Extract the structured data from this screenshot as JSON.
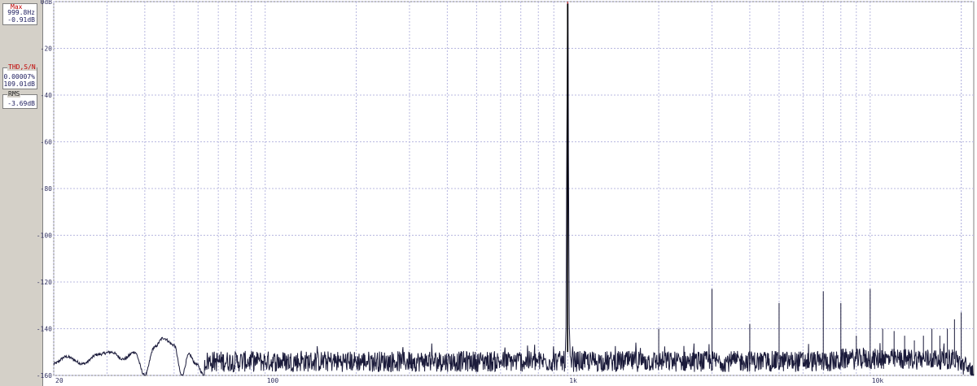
{
  "readouts": {
    "max": {
      "title": "Max",
      "freq": "999.8Hz",
      "level": "-0.91dB"
    },
    "thd": {
      "title": "THD,S/N",
      "thd": "0.00007%",
      "sn": "109.01dB"
    },
    "rms": {
      "title": "RMS",
      "level": "-3.69dB"
    }
  },
  "colors": {
    "trace": "#1a1a3a",
    "grid": "#b8b8e0",
    "panel": "#d4d0c8",
    "marker": "#c00000"
  },
  "chart_data": {
    "type": "line",
    "title": "",
    "xlabel": "",
    "ylabel": "",
    "xscale": "log",
    "xlim": [
      20,
      22000
    ],
    "ylim": [
      -160,
      0
    ],
    "grid": true,
    "yticks": [
      {
        "v": 0,
        "label": "0dB"
      },
      {
        "v": -20,
        "label": "-20"
      },
      {
        "v": -40,
        "label": "-40"
      },
      {
        "v": -60,
        "label": "-60"
      },
      {
        "v": -80,
        "label": "-80"
      },
      {
        "v": -100,
        "label": "-100"
      },
      {
        "v": -120,
        "label": "-120"
      },
      {
        "v": -140,
        "label": "-140"
      },
      {
        "v": -160,
        "label": "-160"
      }
    ],
    "xticks": [
      {
        "v": 20,
        "label": "20"
      },
      {
        "v": 100,
        "label": "100"
      },
      {
        "v": 1000,
        "label": "1k"
      },
      {
        "v": 10000,
        "label": "10k"
      }
    ],
    "noise_floor_db": -154,
    "low_freq_ripple": [
      {
        "f": 20,
        "db": -155
      },
      {
        "f": 22,
        "db": -152
      },
      {
        "f": 25,
        "db": -155
      },
      {
        "f": 28,
        "db": -151
      },
      {
        "f": 31,
        "db": -150
      },
      {
        "f": 34,
        "db": -153
      },
      {
        "f": 37,
        "db": -150
      },
      {
        "f": 40,
        "db": -160
      },
      {
        "f": 43,
        "db": -148
      },
      {
        "f": 46,
        "db": -144
      },
      {
        "f": 50,
        "db": -147
      },
      {
        "f": 53,
        "db": -160
      },
      {
        "f": 56,
        "db": -151
      },
      {
        "f": 59,
        "db": -155
      },
      {
        "f": 63,
        "db": -160
      }
    ],
    "fundamental": {
      "f": 999.8,
      "db": -0.91
    },
    "peaks": [
      {
        "f": 2000,
        "db": -140
      },
      {
        "f": 3000,
        "db": -123
      },
      {
        "f": 4000,
        "db": -138
      },
      {
        "f": 5000,
        "db": -129
      },
      {
        "f": 6000,
        "db": -150
      },
      {
        "f": 7000,
        "db": -124
      },
      {
        "f": 8000,
        "db": -129
      },
      {
        "f": 9000,
        "db": -143
      },
      {
        "f": 10000,
        "db": -123
      },
      {
        "f": 11000,
        "db": -140
      },
      {
        "f": 12000,
        "db": -141
      },
      {
        "f": 13000,
        "db": -143
      },
      {
        "f": 14000,
        "db": -145
      },
      {
        "f": 15000,
        "db": -143
      },
      {
        "f": 16000,
        "db": -140
      },
      {
        "f": 17000,
        "db": -143
      },
      {
        "f": 18000,
        "db": -140
      },
      {
        "f": 19000,
        "db": -136
      },
      {
        "f": 20000,
        "db": -133
      }
    ]
  }
}
